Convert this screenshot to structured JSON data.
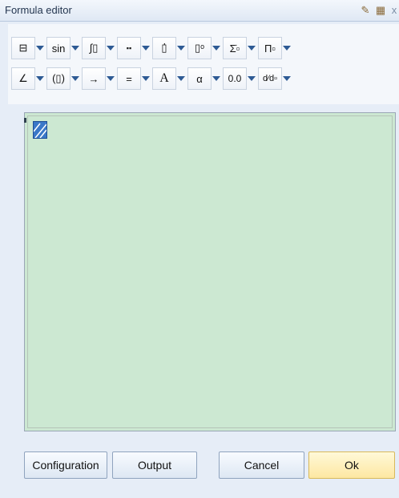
{
  "window": {
    "title": "Formula editor",
    "pin_icon": "pin-icon",
    "dock_icon": "dock-icon",
    "close_label": "x"
  },
  "toolbar": {
    "row1": [
      {
        "name": "fraction",
        "label": "⊟",
        "icon": "fraction-icon"
      },
      {
        "name": "functions",
        "label": "sin",
        "icon": ""
      },
      {
        "name": "integral",
        "label": "∫▯",
        "icon": "integral-icon"
      },
      {
        "name": "matrix",
        "label": "▪▪",
        "icon": "matrix-icon"
      },
      {
        "name": "accent",
        "label": "▯̇",
        "icon": "dot-accent-icon"
      },
      {
        "name": "script",
        "label": "▯ᵒ",
        "icon": "superscript-icon"
      },
      {
        "name": "sum",
        "label": "Σ̇▫",
        "icon": "sum-icon"
      },
      {
        "name": "product",
        "label": "Π▫",
        "icon": "product-icon"
      }
    ],
    "row2": [
      {
        "name": "geometry",
        "label": "∠",
        "icon": "angle-icon"
      },
      {
        "name": "brackets",
        "label": "(▯)",
        "icon": "brackets-icon"
      },
      {
        "name": "arrows",
        "label": "→",
        "icon": "arrow-icon"
      },
      {
        "name": "relations",
        "label": "=",
        "icon": "equals-icon"
      },
      {
        "name": "fonts",
        "label": "A",
        "icon": "font-icon"
      },
      {
        "name": "greek",
        "label": "α",
        "icon": "alpha-icon"
      },
      {
        "name": "numbers",
        "label": "0.0",
        "icon": ""
      },
      {
        "name": "derivative",
        "label": "d⁄d▫",
        "icon": "derivative-icon"
      }
    ]
  },
  "buttons": {
    "configuration": "Configuration",
    "output": "Output",
    "cancel": "Cancel",
    "ok": "Ok"
  },
  "colors": {
    "editor_bg": "#cce8d2",
    "cursor": "#3a78c8",
    "dropdown_arrow": "#2d5a94"
  }
}
